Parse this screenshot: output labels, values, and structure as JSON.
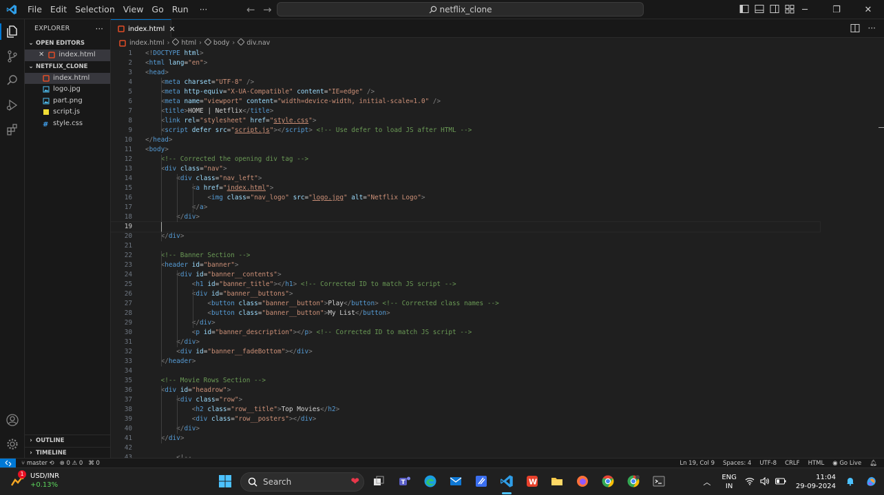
{
  "titlebar": {
    "menu": [
      "File",
      "Edit",
      "Selection",
      "View",
      "Go",
      "Run"
    ],
    "more": "···",
    "command_center": "netflix_clone"
  },
  "sidebar": {
    "title": "EXPLORER",
    "more": "···",
    "open_editors_header": "OPEN EDITORS",
    "open_editors": [
      {
        "name": "index.html",
        "icon": "html-file-icon"
      }
    ],
    "project_header": "NETFLIX_CLONE",
    "files": [
      {
        "name": "index.html",
        "icon": "html-file-icon",
        "selected": true
      },
      {
        "name": "logo.jpg",
        "icon": "image-file-icon"
      },
      {
        "name": "part.png",
        "icon": "image-file-icon"
      },
      {
        "name": "script.js",
        "icon": "js-file-icon"
      },
      {
        "name": "style.css",
        "icon": "css-file-icon"
      }
    ],
    "outline_header": "OUTLINE",
    "timeline_header": "TIMELINE"
  },
  "tabs": [
    {
      "label": "index.html",
      "active": true
    }
  ],
  "breadcrumb": [
    "index.html",
    "html",
    "body",
    "div.nav"
  ],
  "editor": {
    "current_line": 19,
    "lines": [
      [
        [
          "punct",
          "<!"
        ],
        [
          "tag",
          "DOCTYPE"
        ],
        [
          "txt",
          " "
        ],
        [
          "attr",
          "html"
        ],
        [
          "punct",
          ">"
        ]
      ],
      [
        [
          "punct",
          "<"
        ],
        [
          "tag",
          "html"
        ],
        [
          "txt",
          " "
        ],
        [
          "attr",
          "lang"
        ],
        [
          "txt",
          "="
        ],
        [
          "val",
          "\"en\""
        ],
        [
          "punct",
          ">"
        ]
      ],
      [
        [
          "punct",
          "<"
        ],
        [
          "tag",
          "head"
        ],
        [
          "punct",
          ">"
        ]
      ],
      [
        [
          "txt",
          "    "
        ],
        [
          "punct",
          "<"
        ],
        [
          "tag",
          "meta"
        ],
        [
          "txt",
          " "
        ],
        [
          "attr",
          "charset"
        ],
        [
          "txt",
          "="
        ],
        [
          "val",
          "\"UTF-8\""
        ],
        [
          "txt",
          " "
        ],
        [
          "punct",
          "/>"
        ]
      ],
      [
        [
          "txt",
          "    "
        ],
        [
          "punct",
          "<"
        ],
        [
          "tag",
          "meta"
        ],
        [
          "txt",
          " "
        ],
        [
          "attr",
          "http-equiv"
        ],
        [
          "txt",
          "="
        ],
        [
          "val",
          "\"X-UA-Compatible\""
        ],
        [
          "txt",
          " "
        ],
        [
          "attr",
          "content"
        ],
        [
          "txt",
          "="
        ],
        [
          "val",
          "\"IE=edge\""
        ],
        [
          "txt",
          " "
        ],
        [
          "punct",
          "/>"
        ]
      ],
      [
        [
          "txt",
          "    "
        ],
        [
          "punct",
          "<"
        ],
        [
          "tag",
          "meta"
        ],
        [
          "txt",
          " "
        ],
        [
          "attr",
          "name"
        ],
        [
          "txt",
          "="
        ],
        [
          "val",
          "\"viewport\""
        ],
        [
          "txt",
          " "
        ],
        [
          "attr",
          "content"
        ],
        [
          "txt",
          "="
        ],
        [
          "val",
          "\"width=device-width, initial-scale=1.0\""
        ],
        [
          "txt",
          " "
        ],
        [
          "punct",
          "/>"
        ]
      ],
      [
        [
          "txt",
          "    "
        ],
        [
          "punct",
          "<"
        ],
        [
          "tag",
          "title"
        ],
        [
          "punct",
          ">"
        ],
        [
          "txt",
          "HOME | Netflix"
        ],
        [
          "punct",
          "</"
        ],
        [
          "tag",
          "title"
        ],
        [
          "punct",
          ">"
        ]
      ],
      [
        [
          "txt",
          "    "
        ],
        [
          "punct",
          "<"
        ],
        [
          "tag",
          "link"
        ],
        [
          "txt",
          " "
        ],
        [
          "attr",
          "rel"
        ],
        [
          "txt",
          "="
        ],
        [
          "val",
          "\"stylesheet\""
        ],
        [
          "txt",
          " "
        ],
        [
          "attr",
          "href"
        ],
        [
          "txt",
          "="
        ],
        [
          "val",
          "\""
        ],
        [
          "link",
          "style.css"
        ],
        [
          "val",
          "\""
        ],
        [
          "punct",
          ">"
        ]
      ],
      [
        [
          "txt",
          "    "
        ],
        [
          "punct",
          "<"
        ],
        [
          "tag",
          "script"
        ],
        [
          "txt",
          " "
        ],
        [
          "attr",
          "defer"
        ],
        [
          "txt",
          " "
        ],
        [
          "attr",
          "src"
        ],
        [
          "txt",
          "="
        ],
        [
          "val",
          "\""
        ],
        [
          "link",
          "script.js"
        ],
        [
          "val",
          "\""
        ],
        [
          "punct",
          "></"
        ],
        [
          "tag",
          "script"
        ],
        [
          "punct",
          ">"
        ],
        [
          "txt",
          " "
        ],
        [
          "com",
          "<!-- Use defer to load JS after HTML -->"
        ]
      ],
      [
        [
          "punct",
          "</"
        ],
        [
          "tag",
          "head"
        ],
        [
          "punct",
          ">"
        ]
      ],
      [
        [
          "punct",
          "<"
        ],
        [
          "tag",
          "body"
        ],
        [
          "punct",
          ">"
        ]
      ],
      [
        [
          "txt",
          "    "
        ],
        [
          "com",
          "<!-- Corrected the opening div tag -->"
        ]
      ],
      [
        [
          "txt",
          "    "
        ],
        [
          "punct",
          "<"
        ],
        [
          "tag",
          "div"
        ],
        [
          "txt",
          " "
        ],
        [
          "attr",
          "class"
        ],
        [
          "txt",
          "="
        ],
        [
          "val",
          "\"nav\""
        ],
        [
          "punct",
          ">"
        ]
      ],
      [
        [
          "txt",
          "        "
        ],
        [
          "punct",
          "<"
        ],
        [
          "tag",
          "div"
        ],
        [
          "txt",
          " "
        ],
        [
          "attr",
          "class"
        ],
        [
          "txt",
          "="
        ],
        [
          "val",
          "\"nav_left\""
        ],
        [
          "punct",
          ">"
        ]
      ],
      [
        [
          "txt",
          "            "
        ],
        [
          "punct",
          "<"
        ],
        [
          "tag",
          "a"
        ],
        [
          "txt",
          " "
        ],
        [
          "attr",
          "href"
        ],
        [
          "txt",
          "="
        ],
        [
          "val",
          "\""
        ],
        [
          "link",
          "index.html"
        ],
        [
          "val",
          "\""
        ],
        [
          "punct",
          ">"
        ]
      ],
      [
        [
          "txt",
          "                "
        ],
        [
          "punct",
          "<"
        ],
        [
          "tag",
          "img"
        ],
        [
          "txt",
          " "
        ],
        [
          "attr",
          "class"
        ],
        [
          "txt",
          "="
        ],
        [
          "val",
          "\"nav_logo\""
        ],
        [
          "txt",
          " "
        ],
        [
          "attr",
          "src"
        ],
        [
          "txt",
          "="
        ],
        [
          "val",
          "\""
        ],
        [
          "link",
          "logo.jpg"
        ],
        [
          "val",
          "\""
        ],
        [
          "txt",
          " "
        ],
        [
          "attr",
          "alt"
        ],
        [
          "txt",
          "="
        ],
        [
          "val",
          "\"Netflix Logo\""
        ],
        [
          "punct",
          ">"
        ]
      ],
      [
        [
          "txt",
          "            "
        ],
        [
          "punct",
          "</"
        ],
        [
          "tag",
          "a"
        ],
        [
          "punct",
          ">"
        ]
      ],
      [
        [
          "txt",
          "        "
        ],
        [
          "punct",
          "</"
        ],
        [
          "tag",
          "div"
        ],
        [
          "punct",
          ">"
        ]
      ],
      [
        [
          "txt",
          "    "
        ]
      ],
      [
        [
          "txt",
          "    "
        ],
        [
          "punct",
          "</"
        ],
        [
          "tag",
          "div"
        ],
        [
          "punct",
          ">"
        ]
      ],
      [
        [
          "txt",
          ""
        ]
      ],
      [
        [
          "txt",
          "    "
        ],
        [
          "com",
          "<!-- Banner Section -->"
        ]
      ],
      [
        [
          "txt",
          "    "
        ],
        [
          "punct",
          "<"
        ],
        [
          "tag",
          "header"
        ],
        [
          "txt",
          " "
        ],
        [
          "attr",
          "id"
        ],
        [
          "txt",
          "="
        ],
        [
          "val",
          "\"banner\""
        ],
        [
          "punct",
          ">"
        ]
      ],
      [
        [
          "txt",
          "        "
        ],
        [
          "punct",
          "<"
        ],
        [
          "tag",
          "div"
        ],
        [
          "txt",
          " "
        ],
        [
          "attr",
          "id"
        ],
        [
          "txt",
          "="
        ],
        [
          "val",
          "\"banner__contents\""
        ],
        [
          "punct",
          ">"
        ]
      ],
      [
        [
          "txt",
          "            "
        ],
        [
          "punct",
          "<"
        ],
        [
          "tag",
          "h1"
        ],
        [
          "txt",
          " "
        ],
        [
          "attr",
          "id"
        ],
        [
          "txt",
          "="
        ],
        [
          "val",
          "\"banner_title\""
        ],
        [
          "punct",
          "></"
        ],
        [
          "tag",
          "h1"
        ],
        [
          "punct",
          ">"
        ],
        [
          "txt",
          " "
        ],
        [
          "com",
          "<!-- Corrected ID to match JS script -->"
        ]
      ],
      [
        [
          "txt",
          "            "
        ],
        [
          "punct",
          "<"
        ],
        [
          "tag",
          "div"
        ],
        [
          "txt",
          " "
        ],
        [
          "attr",
          "id"
        ],
        [
          "txt",
          "="
        ],
        [
          "val",
          "\"banner__buttons\""
        ],
        [
          "punct",
          ">"
        ]
      ],
      [
        [
          "txt",
          "                "
        ],
        [
          "punct",
          "<"
        ],
        [
          "tag",
          "button"
        ],
        [
          "txt",
          " "
        ],
        [
          "attr",
          "class"
        ],
        [
          "txt",
          "="
        ],
        [
          "val",
          "\"banner__button\""
        ],
        [
          "punct",
          ">"
        ],
        [
          "txt",
          "Play"
        ],
        [
          "punct",
          "</"
        ],
        [
          "tag",
          "button"
        ],
        [
          "punct",
          ">"
        ],
        [
          "txt",
          " "
        ],
        [
          "com",
          "<!-- Corrected class names -->"
        ]
      ],
      [
        [
          "txt",
          "                "
        ],
        [
          "punct",
          "<"
        ],
        [
          "tag",
          "button"
        ],
        [
          "txt",
          " "
        ],
        [
          "attr",
          "class"
        ],
        [
          "txt",
          "="
        ],
        [
          "val",
          "\"banner__button\""
        ],
        [
          "punct",
          ">"
        ],
        [
          "txt",
          "My List"
        ],
        [
          "punct",
          "</"
        ],
        [
          "tag",
          "button"
        ],
        [
          "punct",
          ">"
        ]
      ],
      [
        [
          "txt",
          "            "
        ],
        [
          "punct",
          "</"
        ],
        [
          "tag",
          "div"
        ],
        [
          "punct",
          ">"
        ]
      ],
      [
        [
          "txt",
          "            "
        ],
        [
          "punct",
          "<"
        ],
        [
          "tag",
          "p"
        ],
        [
          "txt",
          " "
        ],
        [
          "attr",
          "id"
        ],
        [
          "txt",
          "="
        ],
        [
          "val",
          "\"banner_description\""
        ],
        [
          "punct",
          "></"
        ],
        [
          "tag",
          "p"
        ],
        [
          "punct",
          ">"
        ],
        [
          "txt",
          " "
        ],
        [
          "com",
          "<!-- Corrected ID to match JS script -->"
        ]
      ],
      [
        [
          "txt",
          "        "
        ],
        [
          "punct",
          "</"
        ],
        [
          "tag",
          "div"
        ],
        [
          "punct",
          ">"
        ]
      ],
      [
        [
          "txt",
          "        "
        ],
        [
          "punct",
          "<"
        ],
        [
          "tag",
          "div"
        ],
        [
          "txt",
          " "
        ],
        [
          "attr",
          "id"
        ],
        [
          "txt",
          "="
        ],
        [
          "val",
          "\"banner__fadeBottom\""
        ],
        [
          "punct",
          "></"
        ],
        [
          "tag",
          "div"
        ],
        [
          "punct",
          ">"
        ]
      ],
      [
        [
          "txt",
          "    "
        ],
        [
          "punct",
          "</"
        ],
        [
          "tag",
          "header"
        ],
        [
          "punct",
          ">"
        ]
      ],
      [
        [
          "txt",
          ""
        ]
      ],
      [
        [
          "txt",
          "    "
        ],
        [
          "com",
          "<!-- Movie Rows Section -->"
        ]
      ],
      [
        [
          "txt",
          "    "
        ],
        [
          "punct",
          "<"
        ],
        [
          "tag",
          "div"
        ],
        [
          "txt",
          " "
        ],
        [
          "attr",
          "id"
        ],
        [
          "txt",
          "="
        ],
        [
          "val",
          "\"headrow\""
        ],
        [
          "punct",
          ">"
        ]
      ],
      [
        [
          "txt",
          "        "
        ],
        [
          "punct",
          "<"
        ],
        [
          "tag",
          "div"
        ],
        [
          "txt",
          " "
        ],
        [
          "attr",
          "class"
        ],
        [
          "txt",
          "="
        ],
        [
          "val",
          "\"row\""
        ],
        [
          "punct",
          ">"
        ]
      ],
      [
        [
          "txt",
          "            "
        ],
        [
          "punct",
          "<"
        ],
        [
          "tag",
          "h2"
        ],
        [
          "txt",
          " "
        ],
        [
          "attr",
          "class"
        ],
        [
          "txt",
          "="
        ],
        [
          "val",
          "\"row__title\""
        ],
        [
          "punct",
          ">"
        ],
        [
          "txt",
          "Top Movies"
        ],
        [
          "punct",
          "</"
        ],
        [
          "tag",
          "h2"
        ],
        [
          "punct",
          ">"
        ]
      ],
      [
        [
          "txt",
          "            "
        ],
        [
          "punct",
          "<"
        ],
        [
          "tag",
          "div"
        ],
        [
          "txt",
          " "
        ],
        [
          "attr",
          "class"
        ],
        [
          "txt",
          "="
        ],
        [
          "val",
          "\"row__posters\""
        ],
        [
          "punct",
          "></"
        ],
        [
          "tag",
          "div"
        ],
        [
          "punct",
          ">"
        ]
      ],
      [
        [
          "txt",
          "        "
        ],
        [
          "punct",
          "</"
        ],
        [
          "tag",
          "div"
        ],
        [
          "punct",
          ">"
        ]
      ],
      [
        [
          "txt",
          "    "
        ],
        [
          "punct",
          "</"
        ],
        [
          "tag",
          "div"
        ],
        [
          "punct",
          ">"
        ]
      ],
      [
        [
          "txt",
          ""
        ]
      ],
      [
        [
          "txt",
          "        "
        ],
        [
          "punct",
          "<!--"
        ]
      ]
    ]
  },
  "statusbar": {
    "branch": "master",
    "problems_errors": "0",
    "problems_warnings": "0",
    "ports": "0",
    "cursor": "Ln 19, Col 9",
    "spaces": "Spaces: 4",
    "encoding": "UTF-8",
    "eol": "CRLF",
    "language": "HTML",
    "golive": "Go Live"
  },
  "taskbar": {
    "widget_badge": "1",
    "widget_title": "USD/INR",
    "widget_change": "+0.13%",
    "search_placeholder": "Search",
    "lang_top": "ENG",
    "lang_bottom": "IN",
    "time": "11:04",
    "date": "29-09-2024"
  },
  "colors": {
    "accent": "#0078d4",
    "html_icon": "#e44d26",
    "js_icon": "#f1dd35",
    "css_icon": "#42a5f5",
    "image_icon": "#4fc3f7",
    "up_green": "#5cd65c"
  }
}
